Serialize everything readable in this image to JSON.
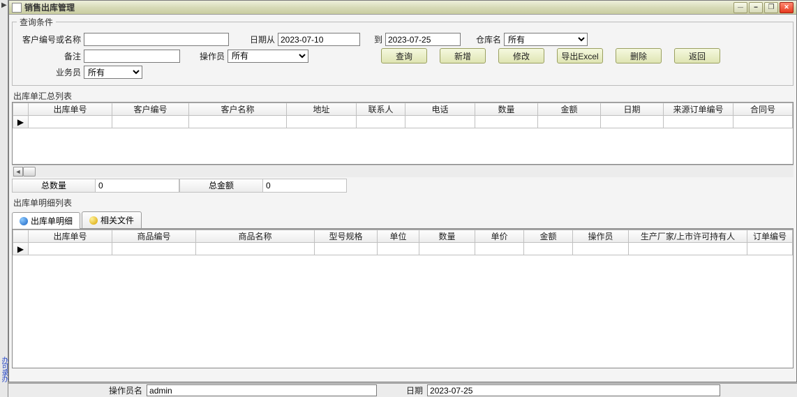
{
  "window": {
    "title": "销售出库管理"
  },
  "query": {
    "legend": "查询条件",
    "customer_label": "客户编号或名称",
    "customer_value": "",
    "date_from_label": "日期从",
    "date_from": "2023-07-10",
    "date_to_label": "到",
    "date_to": "2023-07-25",
    "warehouse_label": "仓库名",
    "warehouse_value": "所有",
    "remark_label": "备注",
    "remark_value": "",
    "operator_label": "操作员",
    "operator_value": "所有",
    "salesman_label": "业务员",
    "salesman_value": "所有"
  },
  "buttons": {
    "query": "查询",
    "add": "新增",
    "edit": "修改",
    "export": "导出Excel",
    "delete": "删除",
    "back": "返回"
  },
  "summary": {
    "title": "出库单汇总列表",
    "headers": [
      "出库单号",
      "客户编号",
      "客户名称",
      "地址",
      "联系人",
      "电话",
      "数量",
      "金额",
      "日期",
      "来源订单编号",
      "合同号"
    ],
    "total_qty_label": "总数量",
    "total_qty": "0",
    "total_amt_label": "总金额",
    "total_amt": "0"
  },
  "detail": {
    "title": "出库单明细列表",
    "tab1": "出库单明细",
    "tab2": "相关文件",
    "headers": [
      "出库单号",
      "商品编号",
      "商品名称",
      "型号规格",
      "单位",
      "数量",
      "单价",
      "金额",
      "操作员",
      "生产厂家/上市许可持有人",
      "订单编号"
    ]
  },
  "status": {
    "operator_label": "操作员名",
    "operator": "admin",
    "date_label": "日期",
    "date": "2023-07-25"
  }
}
